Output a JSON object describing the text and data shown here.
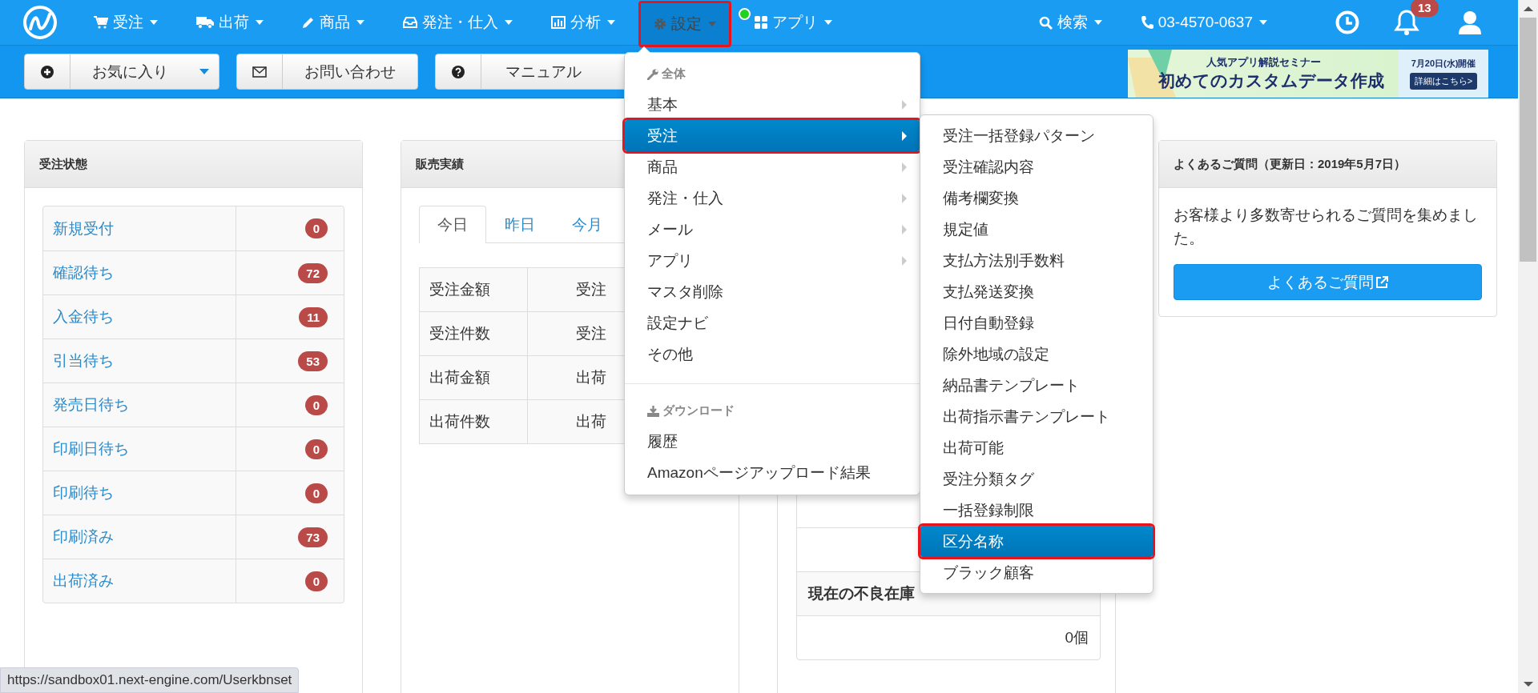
{
  "nav": {
    "items": [
      {
        "label": "受注",
        "selected": false,
        "dot": false
      },
      {
        "label": "出荷",
        "selected": false,
        "dot": false
      },
      {
        "label": "商品",
        "selected": false,
        "dot": false
      },
      {
        "label": "発注・仕入",
        "selected": false,
        "dot": false
      },
      {
        "label": "分析",
        "selected": false,
        "dot": false
      },
      {
        "label": "設定",
        "selected": true,
        "dot": false
      },
      {
        "label": "アプリ",
        "selected": false,
        "dot": true
      }
    ],
    "search": "検索",
    "phone": "03-4570-0637",
    "notifications": "13"
  },
  "toolbar": {
    "buttons": [
      {
        "label": "お気に入り",
        "has_menu": true
      },
      {
        "label": "お問い合わせ",
        "has_menu": false
      },
      {
        "label": "マニュアル",
        "has_menu": false
      }
    ]
  },
  "banner": {
    "subtitle": "人気アプリ解説セミナー",
    "title": "初めてのカスタムデータ作成",
    "date": "7月20日(水)開催",
    "link": "詳細はこちら>"
  },
  "order_status": {
    "title": "受注状態",
    "rows": [
      {
        "label": "新規受付",
        "count": "0"
      },
      {
        "label": "確認待ち",
        "count": "72"
      },
      {
        "label": "入金待ち",
        "count": "11"
      },
      {
        "label": "引当待ち",
        "count": "53"
      },
      {
        "label": "発売日待ち",
        "count": "0"
      },
      {
        "label": "印刷日待ち",
        "count": "0"
      },
      {
        "label": "印刷待ち",
        "count": "0"
      },
      {
        "label": "印刷済み",
        "count": "73"
      },
      {
        "label": "出荷済み",
        "count": "0"
      }
    ]
  },
  "sales": {
    "title": "販売実績",
    "tabs": [
      {
        "label": "今日",
        "selected": true
      },
      {
        "label": "昨日",
        "selected": false
      },
      {
        "label": "今月",
        "selected": false
      }
    ],
    "rows": [
      {
        "label": "受注金額",
        "value": "受注"
      },
      {
        "label": "受注件数",
        "value": "受注"
      },
      {
        "label": "出荷金額",
        "value": "出荷"
      },
      {
        "label": "出荷件数",
        "value": "出荷"
      }
    ]
  },
  "stock": {
    "title": "現在の不良在庫",
    "value": "0個"
  },
  "faq": {
    "title": "よくあるご質問（更新日：2019年5月7日）",
    "text": "お客様より多数寄せられるご質問を集めました。",
    "button": "よくあるご質問"
  },
  "menu": {
    "sections": [
      {
        "header": "全体",
        "items": [
          {
            "label": "基本",
            "submenu": true,
            "selected": false
          },
          {
            "label": "受注",
            "submenu": true,
            "selected": true
          },
          {
            "label": "商品",
            "submenu": true,
            "selected": false
          },
          {
            "label": "発注・仕入",
            "submenu": true,
            "selected": false
          },
          {
            "label": "メール",
            "submenu": true,
            "selected": false
          },
          {
            "label": "アプリ",
            "submenu": true,
            "selected": false
          },
          {
            "label": "マスタ削除",
            "submenu": false,
            "selected": false
          },
          {
            "label": "設定ナビ",
            "submenu": false,
            "selected": false
          },
          {
            "label": "その他",
            "submenu": false,
            "selected": false
          }
        ]
      },
      {
        "header": "ダウンロード",
        "items": [
          {
            "label": "履歴",
            "submenu": false,
            "selected": false
          },
          {
            "label": "Amazonページアップロード結果",
            "submenu": false,
            "selected": false
          }
        ]
      }
    ]
  },
  "submenu": {
    "items": [
      {
        "label": "受注一括登録パターン",
        "selected": false
      },
      {
        "label": "受注確認内容",
        "selected": false
      },
      {
        "label": "備考欄変換",
        "selected": false
      },
      {
        "label": "規定値",
        "selected": false
      },
      {
        "label": "支払方法別手数料",
        "selected": false
      },
      {
        "label": "支払発送変換",
        "selected": false
      },
      {
        "label": "日付自動登録",
        "selected": false
      },
      {
        "label": "除外地域の設定",
        "selected": false
      },
      {
        "label": "納品書テンプレート",
        "selected": false
      },
      {
        "label": "出荷指示書テンプレート",
        "selected": false
      },
      {
        "label": "出荷可能",
        "selected": false
      },
      {
        "label": "受注分類タグ",
        "selected": false
      },
      {
        "label": "一括登録制限",
        "selected": false
      },
      {
        "label": "区分名称",
        "selected": true
      },
      {
        "label": "ブラック顧客",
        "selected": false
      }
    ]
  },
  "status_url": "https://sandbox01.next-engine.com/Userkbnset"
}
